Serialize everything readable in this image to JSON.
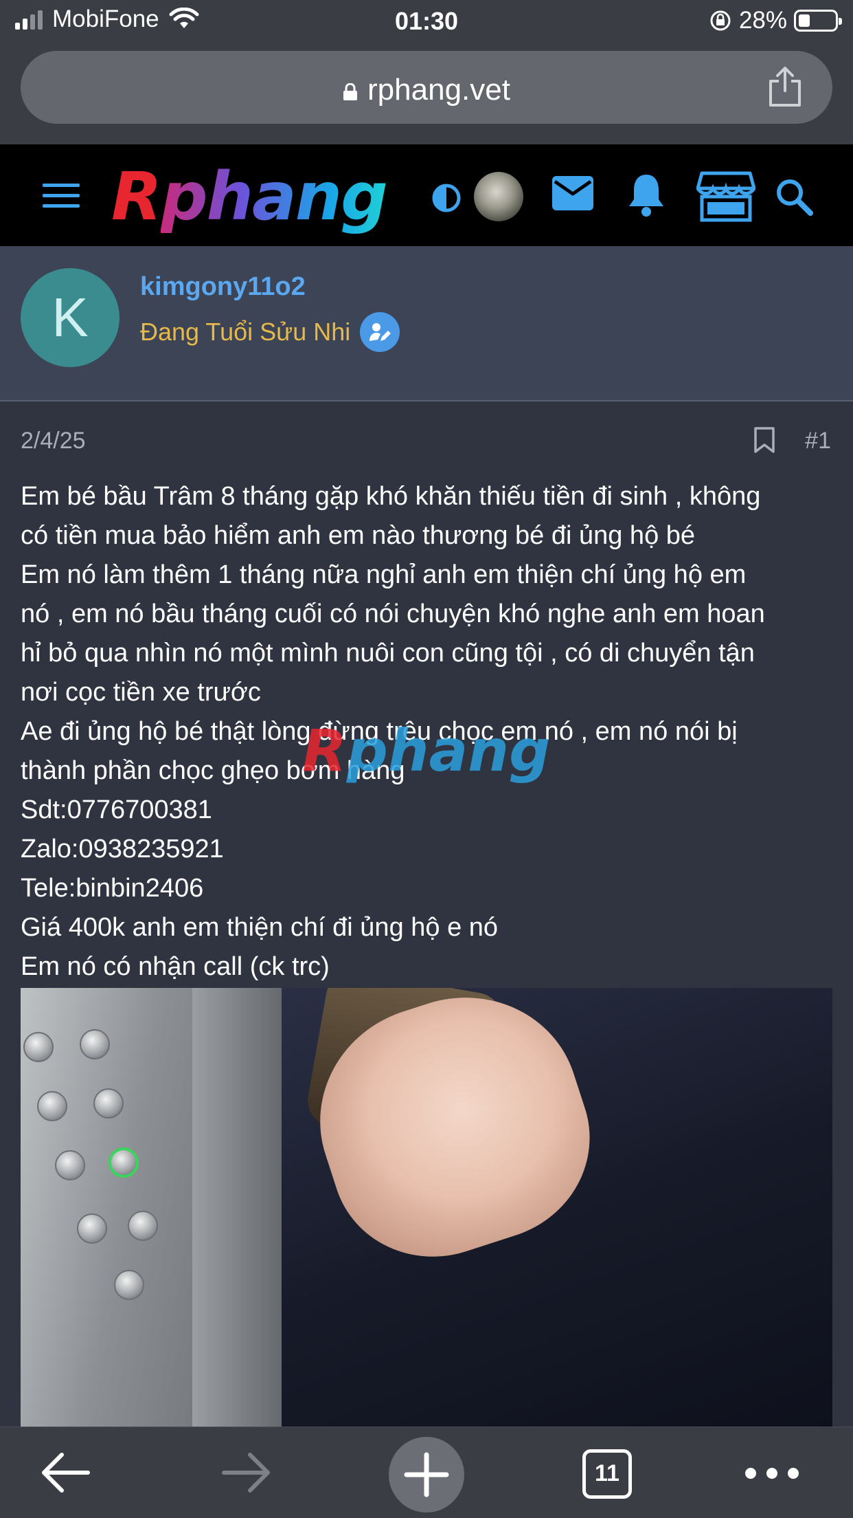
{
  "status_bar": {
    "carrier": "MobiFone",
    "time": "01:30",
    "battery": "28%"
  },
  "browser": {
    "url": "rphang.vet",
    "tab_count": "11"
  },
  "site": {
    "logo_first": "R",
    "logo_rest": "phang"
  },
  "user": {
    "avatar_letter": "K",
    "name": "kimgony11o2",
    "title": "Đang Tuổi Sửu Nhi"
  },
  "post": {
    "date": "2/4/25",
    "number": "#1",
    "lines": [
      "Em bé bầu Trâm 8 tháng gặp khó khăn thiếu tiền đi sinh , không",
      "có tiền mua bảo hiểm anh em nào thương bé đi ủng hộ bé",
      "Em nó làm thêm 1 tháng nữa nghỉ anh em thiện chí ủng hộ em",
      "nó , em nó bầu tháng cuối có nói chuyện khó nghe anh em hoan",
      "hỉ bỏ qua nhìn nó một mình nuôi con cũng tội , có di chuyển tận",
      "nơi cọc tiền xe trước",
      "Ae đi ủng hộ bé thật lòng đừng trêu chọc em nó , em nó nói bị",
      "thành phần chọc ghẹo bơm hàng",
      "Sdt:0776700381",
      "Zalo:0938235921",
      "Tele:binbin2406",
      "Giá 400k anh em thiện chí đi ủng hộ e nó",
      "Em nó có nhận call (ck trc)"
    ]
  },
  "icons": [
    "hamburger-icon",
    "theme-toggle-icon",
    "mail-icon",
    "bell-icon",
    "store-icon",
    "search-icon",
    "bookmark-icon",
    "back-icon",
    "forward-icon",
    "plus-icon",
    "tabs-icon",
    "more-icon",
    "share-icon",
    "lock-icon"
  ]
}
